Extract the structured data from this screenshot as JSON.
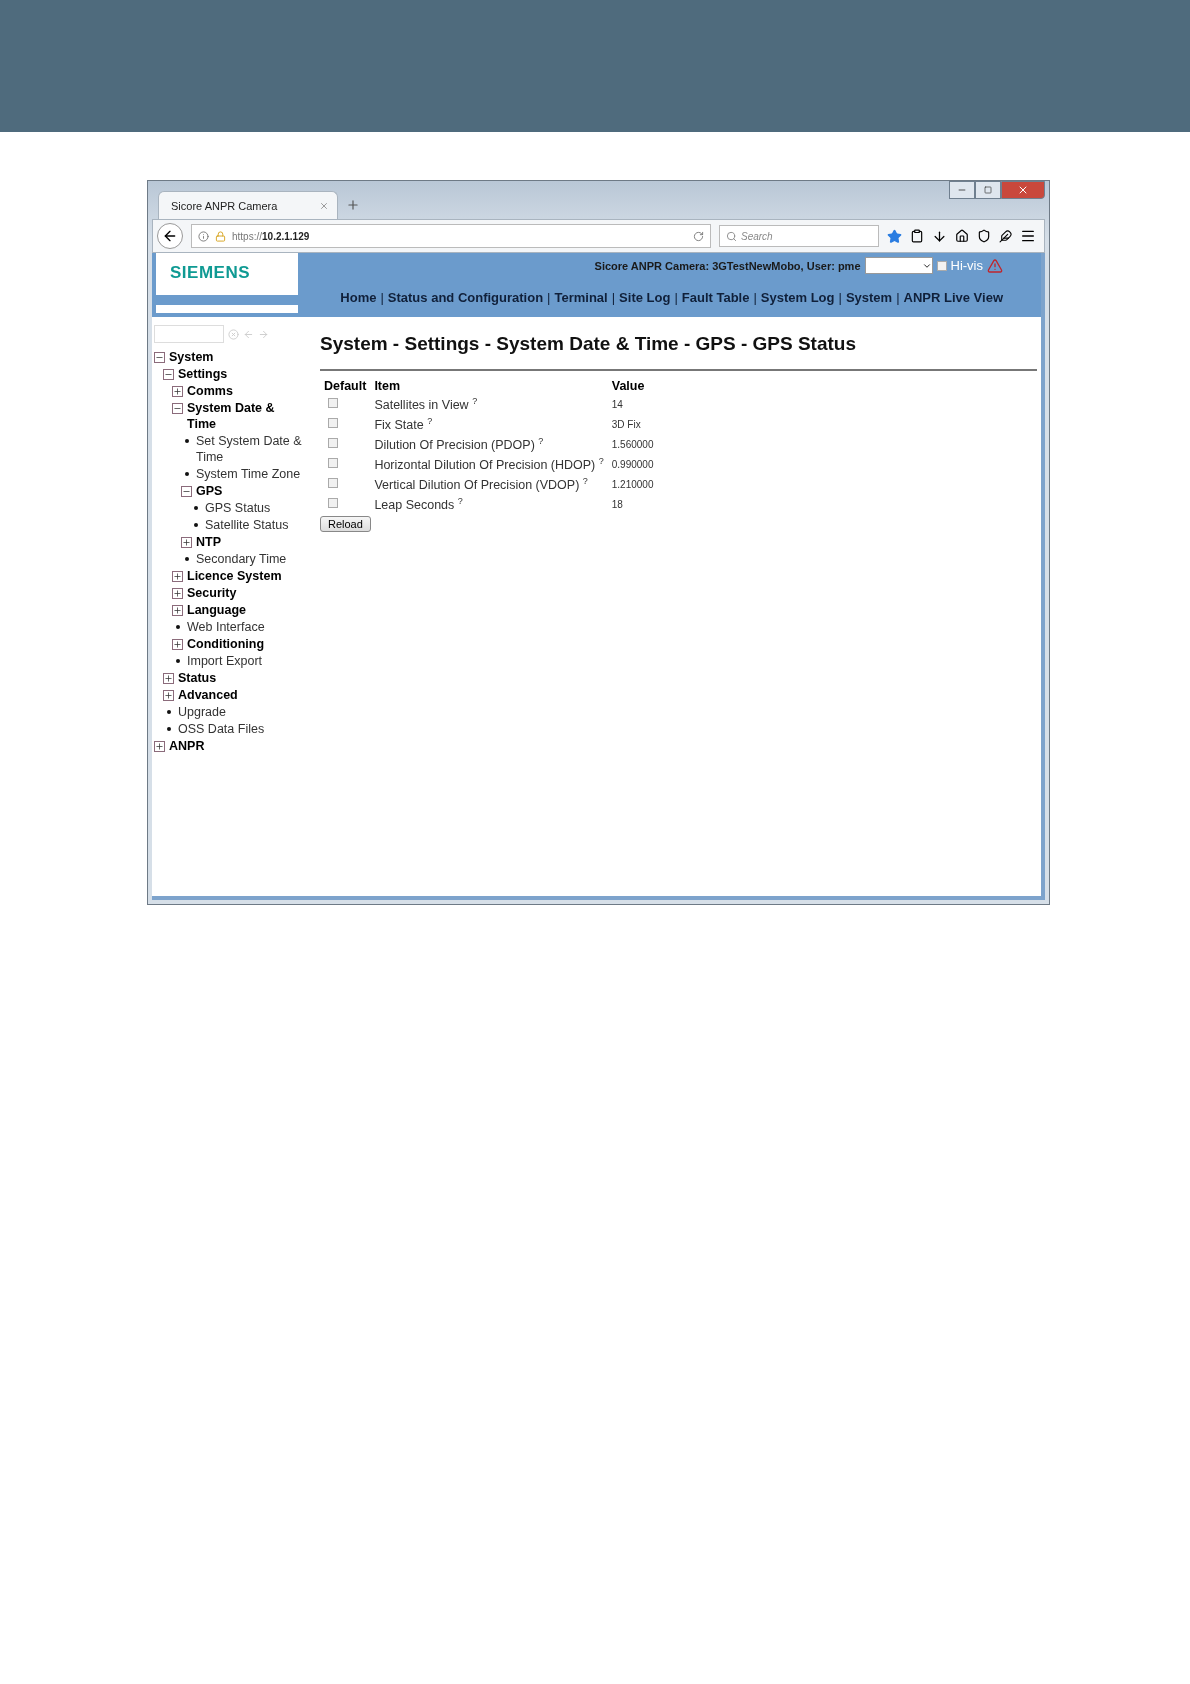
{
  "browser": {
    "tab_title": "Sicore ANPR Camera",
    "url": "https://**10.2.1.129**",
    "search_placeholder": "Search"
  },
  "header": {
    "logo": "SIEMENS",
    "status": "Sicore ANPR Camera: 3GTestNewMobo, User: pme",
    "hi_vis": {
      "label": "Hi-vis",
      "checked": false
    },
    "nav": [
      {
        "kind": "link",
        "text": "Home"
      },
      {
        "kind": "separator",
        "text": "|"
      },
      {
        "kind": "link",
        "text": "Status and Configuration"
      },
      {
        "kind": "separator",
        "text": "|"
      },
      {
        "kind": "link",
        "text": "Terminal"
      },
      {
        "kind": "separator",
        "text": "|"
      },
      {
        "kind": "link",
        "text": "Site Log"
      },
      {
        "kind": "separator",
        "text": "|"
      },
      {
        "kind": "link",
        "text": "Fault Table"
      },
      {
        "kind": "separator",
        "text": "|"
      },
      {
        "kind": "link",
        "text": "System Log"
      },
      {
        "kind": "separator",
        "text": "|"
      },
      {
        "kind": "link",
        "text": "System"
      },
      {
        "kind": "separator",
        "text": "|"
      },
      {
        "kind": "link",
        "text": "ANPR Live View"
      }
    ]
  },
  "tree": [
    {
      "label": "System",
      "kind": "folder",
      "expanded": true,
      "children": [
        {
          "label": "Settings",
          "kind": "folder",
          "expanded": true,
          "children": [
            {
              "label": "Comms",
              "kind": "folder",
              "expanded": false
            },
            {
              "label": "System Date & Time",
              "kind": "folder",
              "expanded": true,
              "children": [
                {
                  "label": "Set System Date & Time",
                  "kind": "leaf"
                },
                {
                  "label": "System Time Zone",
                  "kind": "leaf"
                },
                {
                  "label": "GPS",
                  "kind": "folder",
                  "expanded": true,
                  "children": [
                    {
                      "label": "GPS Status",
                      "kind": "leaf"
                    },
                    {
                      "label": "Satellite Status",
                      "kind": "leaf"
                    }
                  ]
                },
                {
                  "label": "NTP",
                  "kind": "folder",
                  "expanded": false
                },
                {
                  "label": "Secondary Time",
                  "kind": "leaf"
                }
              ]
            },
            {
              "label": "Licence System",
              "kind": "folder",
              "expanded": false
            },
            {
              "label": "Security",
              "kind": "folder",
              "expanded": false
            },
            {
              "label": "Language",
              "kind": "folder",
              "expanded": false
            },
            {
              "label": "Web Interface",
              "kind": "leaf"
            },
            {
              "label": "Conditioning",
              "kind": "folder",
              "expanded": false
            },
            {
              "label": "Import Export",
              "kind": "leaf"
            }
          ]
        },
        {
          "label": "Status",
          "kind": "folder",
          "expanded": false
        },
        {
          "label": "Advanced",
          "kind": "folder",
          "expanded": false
        },
        {
          "label": "Upgrade",
          "kind": "leaf"
        },
        {
          "label": "OSS Data Files",
          "kind": "leaf"
        }
      ]
    },
    {
      "label": "ANPR",
      "kind": "folder",
      "expanded": false
    }
  ],
  "page_title": "System - Settings - System Date & Time - GPS - GPS Status",
  "table": {
    "columns": [
      "Default",
      "Item",
      "Value"
    ],
    "rows": [
      {
        "default_checked": false,
        "item": "Satellites in View $^{?}$",
        "value": "14"
      },
      {
        "default_checked": false,
        "item": "Fix State $^{?}$",
        "value": "3D Fix"
      },
      {
        "default_checked": false,
        "item": "Dilution Of Precision (PDOP) $^{?}$",
        "value": "1.560000"
      },
      {
        "default_checked": false,
        "item": "Horizontal Dilution Of Precision (HDOP) $^{?}$",
        "value": "0.990000"
      },
      {
        "default_checked": false,
        "item": "Vertical Dilution Of Precision (VDOP) $^{?}$",
        "value": "1.210000"
      },
      {
        "default_checked": false,
        "item": "Leap Seconds $^{?}$",
        "value": "18"
      }
    ]
  },
  "reload_button": "Reload"
}
